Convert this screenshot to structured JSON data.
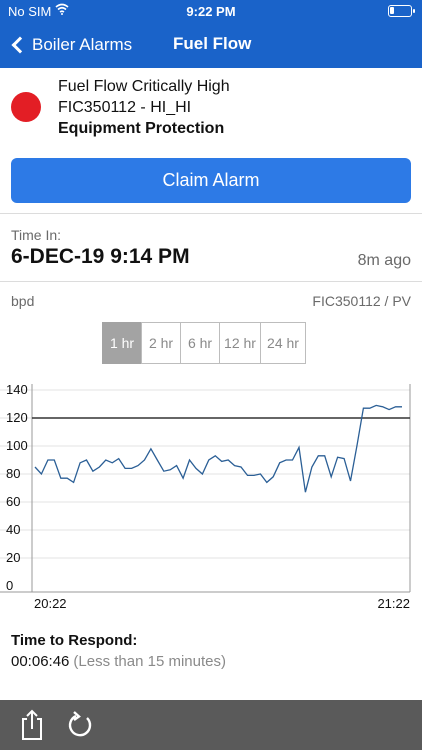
{
  "status_bar": {
    "carrier": "No SIM",
    "time": "9:22 PM"
  },
  "nav": {
    "back_label": "Boiler Alarms",
    "title": "Fuel Flow"
  },
  "alarm": {
    "title": "Fuel Flow Critically High",
    "tag": "FIC350112 - HI_HI",
    "category": "Equipment Protection",
    "severity_color": "#e31e25"
  },
  "claim_button_label": "Claim Alarm",
  "time_in": {
    "label": "Time In:",
    "value": "6-DEC-19 9:14 PM",
    "ago": "8m ago"
  },
  "trend": {
    "unit": "bpd",
    "tag": "FIC350112 / PV",
    "ranges": [
      "1 hr",
      "2 hr",
      "6 hr",
      "12 hr",
      "24 hr"
    ],
    "selected_range": "1 hr"
  },
  "chart_data": {
    "type": "line",
    "x_tick_labels": [
      "20:22",
      "21:22"
    ],
    "y_ticks": [
      0,
      20,
      40,
      60,
      80,
      100,
      120,
      140
    ],
    "ylim": [
      0,
      140
    ],
    "threshold": 120,
    "series": [
      {
        "values": [
          85,
          80,
          90,
          90,
          77,
          77,
          74,
          88,
          90,
          82,
          85,
          90,
          88,
          91,
          84,
          84,
          86,
          90,
          98,
          90,
          82,
          83,
          86,
          77,
          90,
          84,
          80,
          90,
          93,
          89,
          90,
          86,
          85,
          79,
          79,
          80,
          74,
          78,
          88,
          90,
          90,
          99,
          67,
          85,
          93,
          93,
          78,
          92,
          91,
          75,
          100,
          127,
          127,
          129,
          128,
          126,
          128,
          128
        ]
      }
    ],
    "grid": "horizontal",
    "line_color": "#2b5f96",
    "threshold_color": "#333333"
  },
  "time_to_respond": {
    "label": "Time to Respond:",
    "value": "00:06:46",
    "note": "(Less than 15 minutes)"
  },
  "toolbar": {
    "share_icon": "share-icon",
    "refresh_icon": "refresh-icon"
  }
}
